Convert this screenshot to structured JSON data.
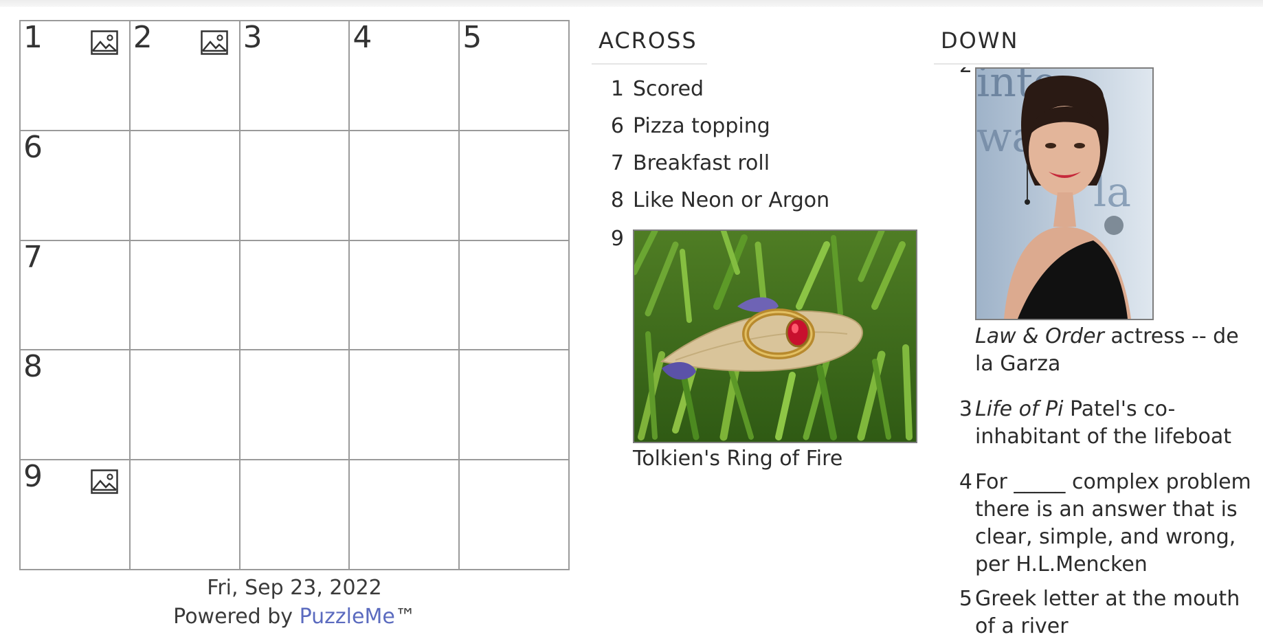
{
  "grid": {
    "rows": 5,
    "cols": 5,
    "cells": [
      {
        "num": "1",
        "image_icon": true
      },
      {
        "num": "2",
        "image_icon": true
      },
      {
        "num": "3",
        "image_icon": false
      },
      {
        "num": "4",
        "image_icon": false
      },
      {
        "num": "5",
        "image_icon": false
      },
      {
        "num": "6",
        "image_icon": false
      },
      {
        "num": "",
        "image_icon": false
      },
      {
        "num": "",
        "image_icon": false
      },
      {
        "num": "",
        "image_icon": false
      },
      {
        "num": "",
        "image_icon": false
      },
      {
        "num": "7",
        "image_icon": false
      },
      {
        "num": "",
        "image_icon": false
      },
      {
        "num": "",
        "image_icon": false
      },
      {
        "num": "",
        "image_icon": false
      },
      {
        "num": "",
        "image_icon": false
      },
      {
        "num": "8",
        "image_icon": false
      },
      {
        "num": "",
        "image_icon": false
      },
      {
        "num": "",
        "image_icon": false
      },
      {
        "num": "",
        "image_icon": false
      },
      {
        "num": "",
        "image_icon": false
      },
      {
        "num": "9",
        "image_icon": true
      },
      {
        "num": "",
        "image_icon": false
      },
      {
        "num": "",
        "image_icon": false
      },
      {
        "num": "",
        "image_icon": false
      },
      {
        "num": "",
        "image_icon": false
      }
    ]
  },
  "footer": {
    "date": "Fri, Sep 23, 2022",
    "powered_by": "Powered by ",
    "brand": "PuzzleMe",
    "trademark": "™"
  },
  "across": {
    "heading": "ACROSS",
    "clues": [
      {
        "num": "1",
        "text": "Scored"
      },
      {
        "num": "6",
        "text": "Pizza topping"
      },
      {
        "num": "7",
        "text": "Breakfast roll"
      },
      {
        "num": "8",
        "text": "Like Neon or Argon"
      },
      {
        "num": "9",
        "caption": "Tolkien's Ring of Fire",
        "image_icon": "ring-photo"
      }
    ]
  },
  "down": {
    "heading": "DOWN",
    "clues": [
      {
        "num": "2",
        "caption_italic": "Law & Order",
        "caption_rest": " actress -- de la Garza",
        "image_icon": "actress-photo"
      },
      {
        "num": "3",
        "text_italic": "Life of Pi",
        "text_rest": " Patel's co-inhabitant of the lifeboat"
      },
      {
        "num": "4",
        "text": "For _____ complex problem there is an answer that is clear, simple, and wrong, per H.L.Mencken"
      },
      {
        "num": "5",
        "text": "Greek letter at the mouth of a river"
      }
    ]
  },
  "colors": {
    "grid_line": "#9a9a9a",
    "link": "#5b6bbf",
    "text": "#2b2b2b"
  }
}
